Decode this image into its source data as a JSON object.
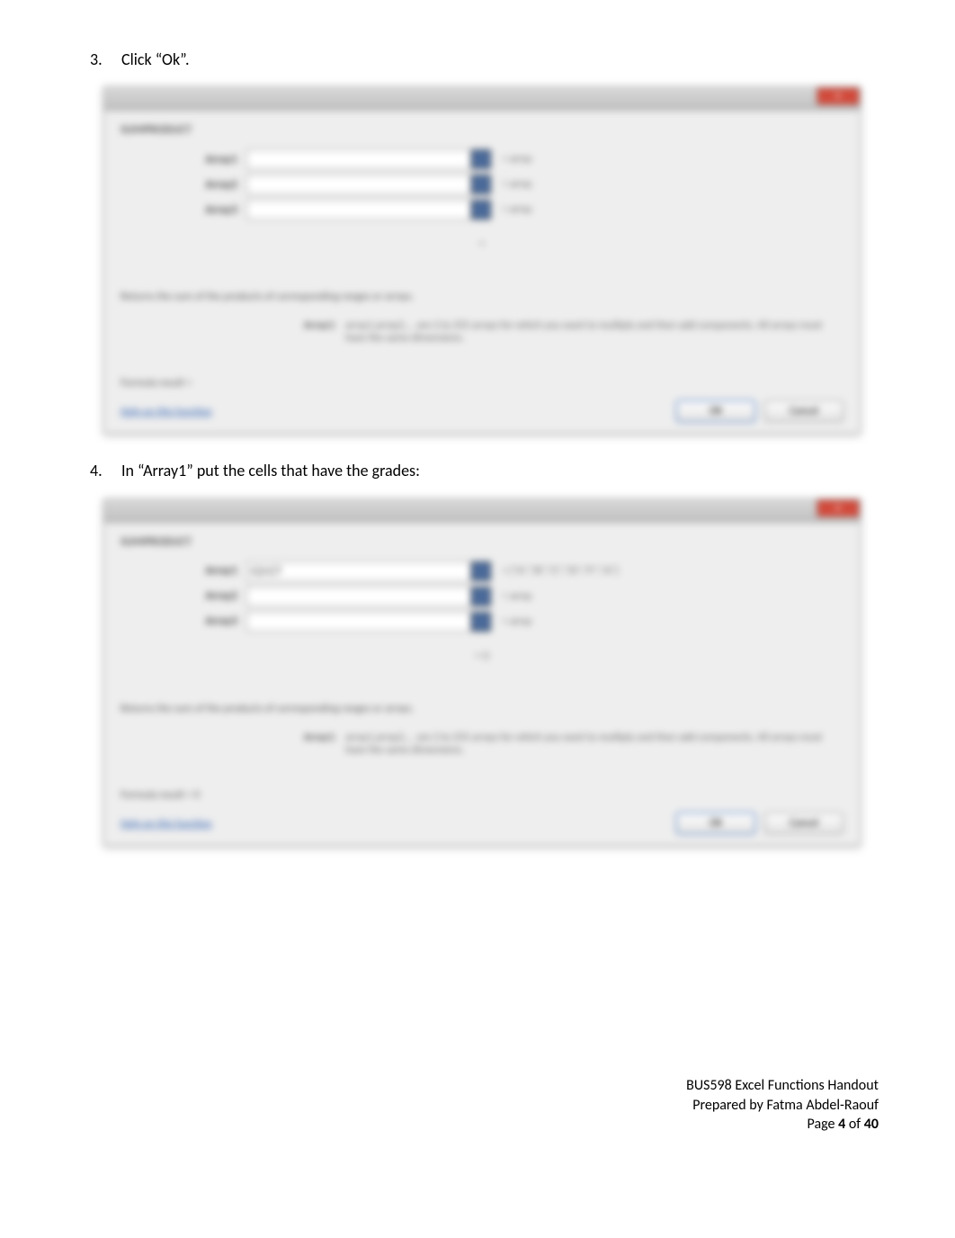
{
  "steps": {
    "step3": {
      "num": "3.",
      "text": "Click “Ok”."
    },
    "step4": {
      "num": "4.",
      "text": "In “Array1” put the cells that have the grades:"
    }
  },
  "dialog1": {
    "section": "SUMPRODUCT",
    "args": {
      "a1": {
        "label": "Array1",
        "value": "",
        "result": "= array"
      },
      "a2": {
        "label": "Array2",
        "value": "",
        "result": "= array"
      },
      "a3": {
        "label": "Array3",
        "value": "",
        "result": "= array"
      }
    },
    "equals": "=",
    "summary": "Returns the sum of the products of corresponding ranges or arrays.",
    "descLabel": "Array1:",
    "descText": "array1,array2,... are 2 to 255 arrays for which you want to multiply and then add components. All arrays must have the same dimensions.",
    "formulaResult": "Formula result =",
    "help": "Help on this function",
    "ok": "OK",
    "cancel": "Cancel"
  },
  "dialog2": {
    "section": "SUMPRODUCT",
    "args": {
      "a1": {
        "label": "Array1",
        "value": "C2:C7",
        "result": "= {\"A\";\"B\";\"C\";\"D\";\"F\";\"A\"}"
      },
      "a2": {
        "label": "Array2",
        "value": "",
        "result": "= array"
      },
      "a3": {
        "label": "Array3",
        "value": "",
        "result": "= array"
      }
    },
    "equals": "= 0",
    "summary": "Returns the sum of the products of corresponding ranges or arrays.",
    "descLabel": "Array1:",
    "descText": "array1,array2,... are 2 to 255 arrays for which you want to multiply and then add components. All arrays must have the same dimensions.",
    "formulaResult": "Formula result = 0",
    "help": "Help on this function",
    "ok": "OK",
    "cancel": "Cancel"
  },
  "footer": {
    "line1": "BUS598 Excel Functions Handout",
    "line2": "Prepared by Fatma Abdel-Raouf",
    "pagePrefix": "Page ",
    "pageNum": "4",
    "pageMid": " of ",
    "pageTotal": "40"
  }
}
